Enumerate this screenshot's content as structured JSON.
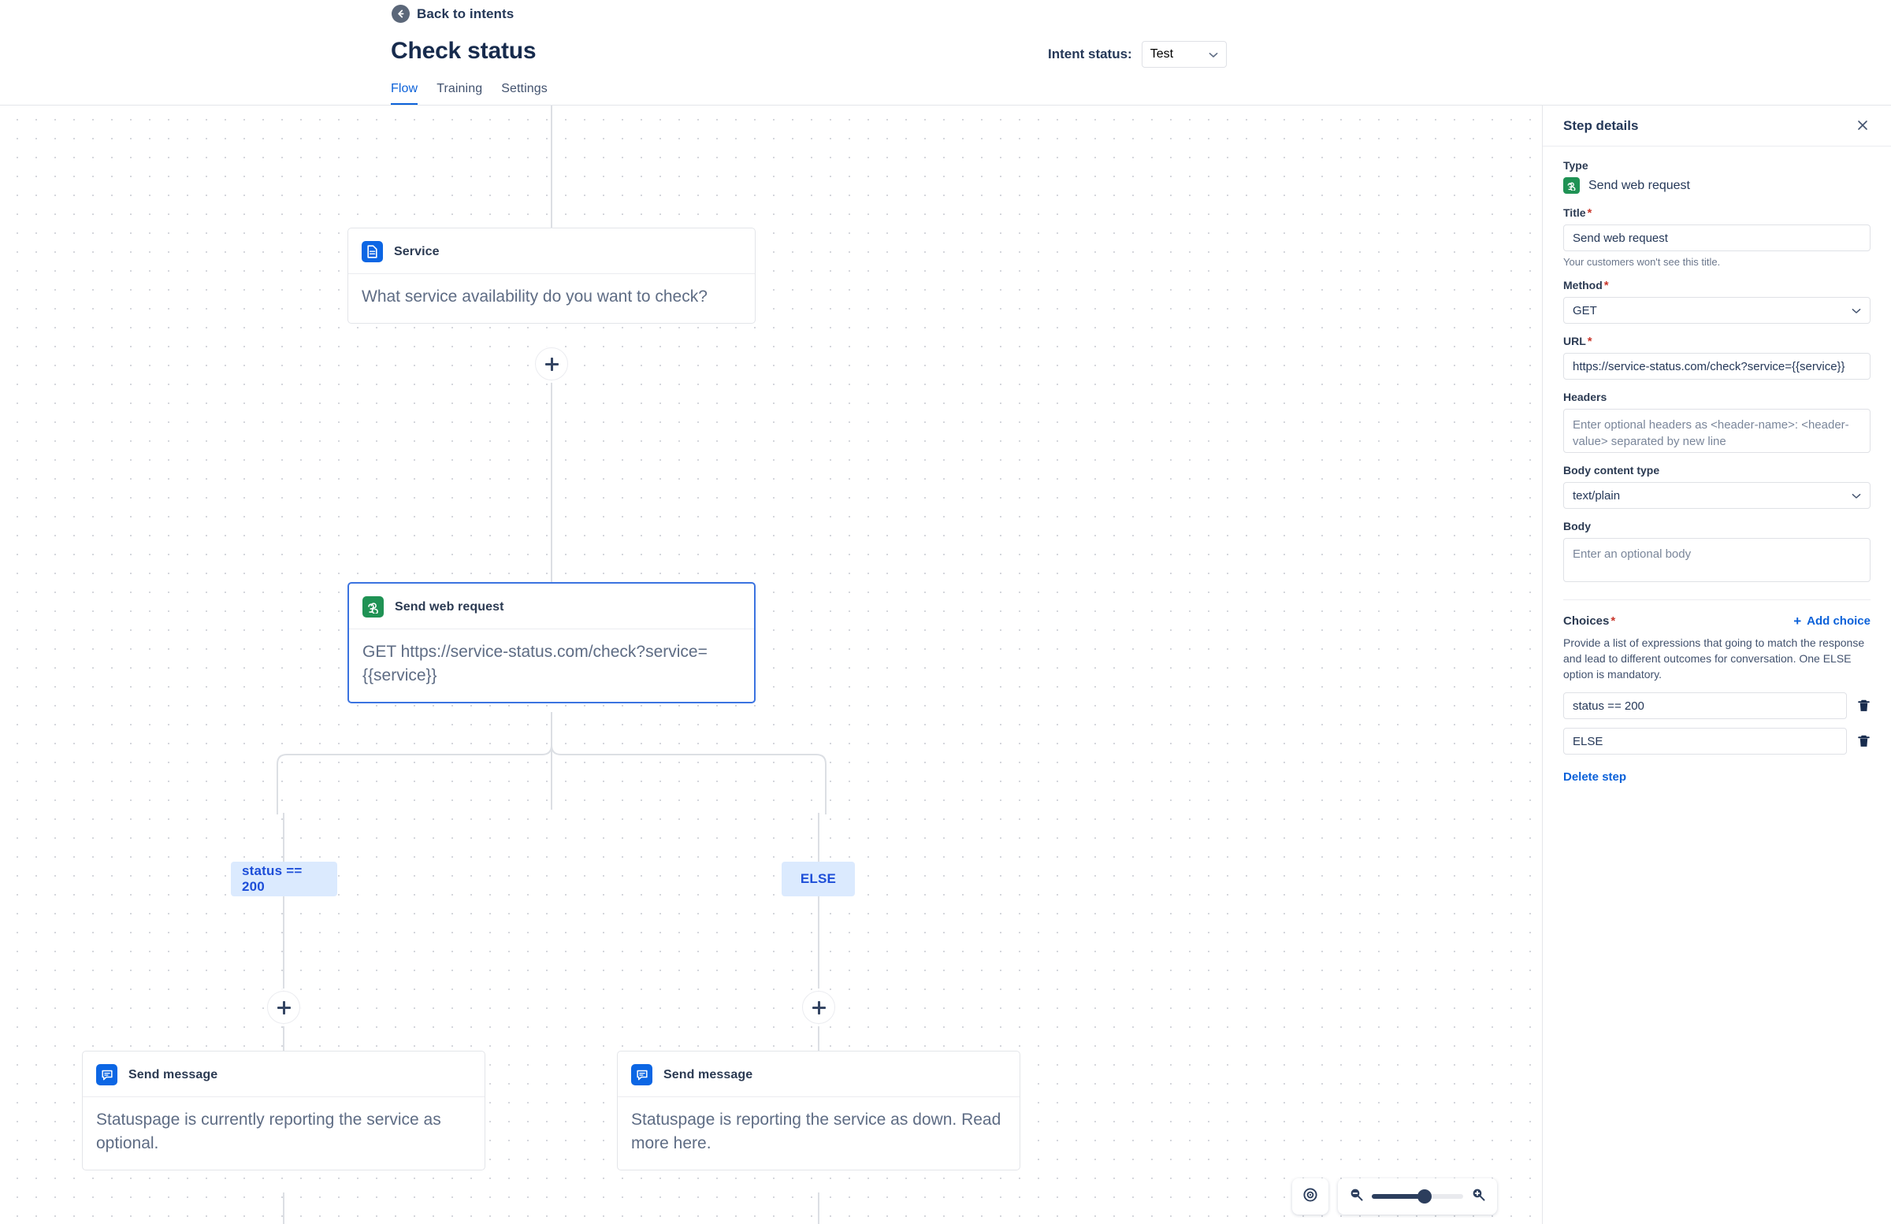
{
  "header": {
    "back_label": "Back to intents",
    "back_icon": "arrow-left-circle-icon",
    "title": "Check status",
    "intent_status_label": "Intent status:",
    "intent_status_value": "Test",
    "tabs": [
      {
        "label": "Flow",
        "active": true
      },
      {
        "label": "Training",
        "active": false
      },
      {
        "label": "Settings",
        "active": false
      }
    ]
  },
  "canvas": {
    "nodes": [
      {
        "id": "service",
        "icon": "document-icon",
        "badge_color": "#0c66e4",
        "title": "Service",
        "body": "What service availability do you want to check?",
        "selected": false
      },
      {
        "id": "send-web-request",
        "icon": "webhook-icon",
        "badge_color": "#1f9254",
        "title": "Send web request",
        "body": "GET https://service-status.com/check?service={{service}}",
        "selected": true
      },
      {
        "id": "send-message-left",
        "icon": "message-icon",
        "badge_color": "#0c66e4",
        "title": "Send message",
        "body": "Statuspage is currently reporting the service as optional.",
        "selected": false
      },
      {
        "id": "send-message-right",
        "icon": "message-icon",
        "badge_color": "#0c66e4",
        "title": "Send message",
        "body": "Statuspage is reporting the service as down. Read more here.",
        "selected": false
      }
    ],
    "branch_chips": [
      {
        "label": "status == 200"
      },
      {
        "label": "ELSE"
      }
    ],
    "add_step_button_label": "+",
    "zoom_controls": {
      "recenter_icon": "target-icon",
      "zoom_out_icon": "zoom-out-icon",
      "zoom_in_icon": "zoom-in-icon",
      "slider_position_percent": 50
    }
  },
  "panel": {
    "title": "Step details",
    "close_icon": "close-icon",
    "type_label": "Type",
    "type_icon": "webhook-icon",
    "type_value": "Send web request",
    "title_label": "Title",
    "title_required": "*",
    "title_value": "Send web request",
    "title_hint": "Your customers won't see this title.",
    "method_label": "Method",
    "method_required": "*",
    "method_value": "GET",
    "url_label": "URL",
    "url_required": "*",
    "url_value": "https://service-status.com/check?service={{service}}",
    "headers_label": "Headers",
    "headers_placeholder": "Enter optional headers as <header-name>: <header-value> separated by new line",
    "body_content_type_label": "Body content type",
    "body_content_type_value": "text/plain",
    "body_label": "Body",
    "body_placeholder": "Enter an optional body",
    "choices_label": "Choices",
    "choices_required": "*",
    "add_choice_label": "Add choice",
    "choices_description": "Provide a list of expressions that going to match the response and lead to different outcomes for conversation. One ELSE option is mandatory.",
    "choices": [
      {
        "value": "status == 200",
        "delete_icon": "trash-icon"
      },
      {
        "value": "ELSE",
        "delete_icon": "trash-icon"
      }
    ],
    "delete_step_label": "Delete step"
  },
  "colors": {
    "accent_blue": "#0b61d9",
    "node_selected_border": "#3b73e0",
    "chip_bg": "#dbeafe",
    "chip_text": "#1d4ed8",
    "badge_green": "#1f9254",
    "badge_blue": "#0c66e4",
    "required_red": "#c9372c"
  }
}
